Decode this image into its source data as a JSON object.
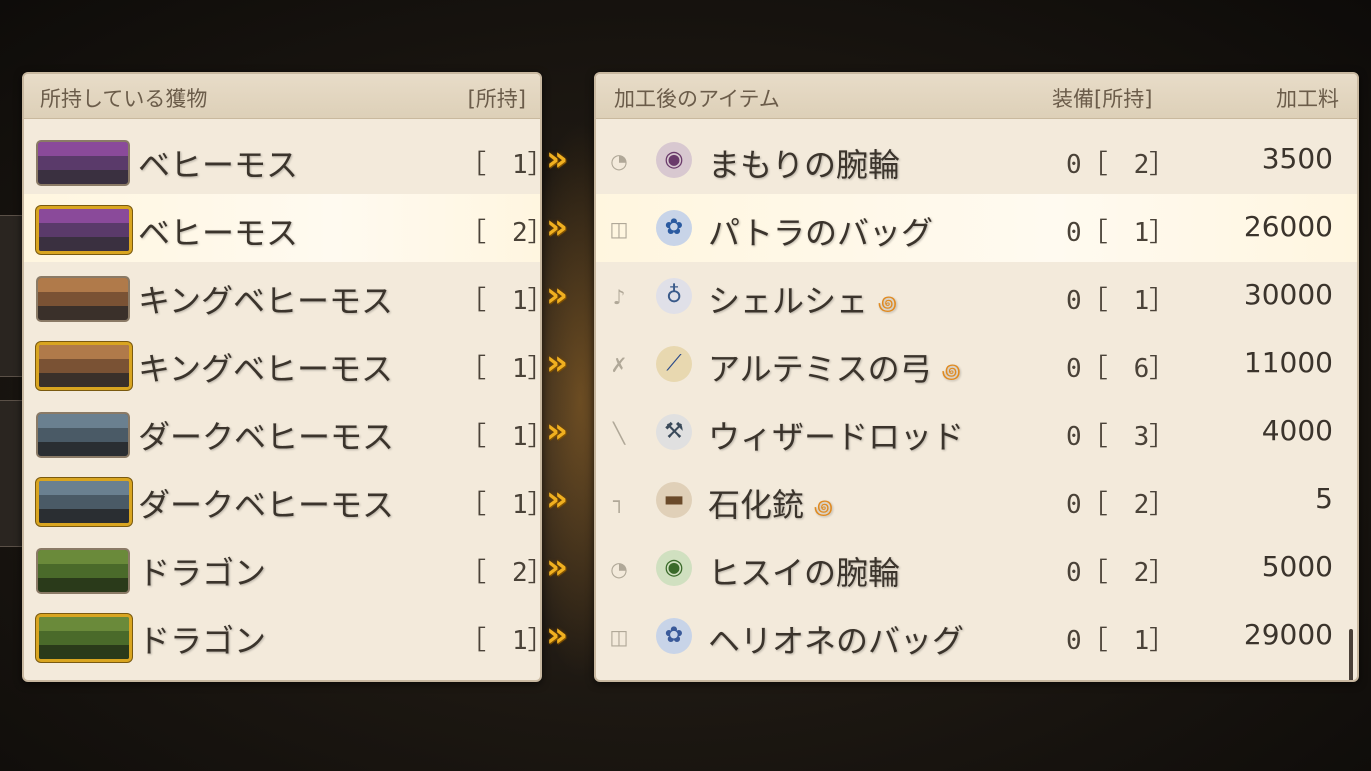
{
  "left_panel": {
    "header_title": "所持している獲物",
    "header_owned": "[所持]",
    "items": [
      {
        "name": "ベヒーモス",
        "sparkle": "",
        "count": "［　1］",
        "gold": false,
        "colors": [
          "#8a4a9a",
          "#5a3a6a",
          "#3a3040"
        ]
      },
      {
        "name": "ベヒーモス",
        "sparkle": "✦",
        "count": "［　2］",
        "gold": true,
        "colors": [
          "#8a4a9a",
          "#5a3a6a",
          "#3a3040"
        ]
      },
      {
        "name": "キングベヒーモス",
        "sparkle": "",
        "count": "［　1］",
        "gold": false,
        "colors": [
          "#b07a4a",
          "#7a5234",
          "#3a302a"
        ]
      },
      {
        "name": "キングベヒーモス",
        "sparkle": "✦",
        "count": "［　1］",
        "gold": true,
        "colors": [
          "#b07a4a",
          "#7a5234",
          "#3a302a"
        ]
      },
      {
        "name": "ダークベヒーモス",
        "sparkle": "",
        "count": "［　1］",
        "gold": false,
        "colors": [
          "#6a8090",
          "#4a5a66",
          "#2a2e32"
        ]
      },
      {
        "name": "ダークベヒーモス",
        "sparkle": "✦",
        "count": "［　1］",
        "gold": true,
        "colors": [
          "#6a8090",
          "#4a5a66",
          "#2a2e32"
        ]
      },
      {
        "name": "ドラゴン",
        "sparkle": "",
        "count": "［　2］",
        "gold": false,
        "colors": [
          "#6a8a3a",
          "#4a6a2a",
          "#2a3a1a"
        ]
      },
      {
        "name": "ドラゴン",
        "sparkle": "✦",
        "count": "［　1］",
        "gold": true,
        "colors": [
          "#6a8a3a",
          "#4a6a2a",
          "#2a3a1a"
        ]
      }
    ]
  },
  "right_panel": {
    "header_title": "加工後のアイテム",
    "header_equip": "装備[所持]",
    "header_fee": "加工料",
    "items": [
      {
        "category_icon": "bracelet-category-icon",
        "cat_glyph": "◔",
        "icon": "bracelet-icon",
        "icon_glyph": "◉",
        "icon_color": "#6a3a6a",
        "icon_bg": "#d8c8d0",
        "name": "まもりの腕輪",
        "material": "",
        "equip": "0［　2］",
        "fee": "3500"
      },
      {
        "category_icon": "bag-category-icon",
        "cat_glyph": "◫",
        "icon": "bag-icon",
        "icon_glyph": "✿",
        "icon_color": "#2a5aa0",
        "icon_bg": "#c8d4e8",
        "name": "パトラのバッグ",
        "material": "",
        "equip": "0［　1］",
        "fee": "26000"
      },
      {
        "category_icon": "accessory-category-icon",
        "cat_glyph": "♪",
        "icon": "potion-icon",
        "icon_glyph": "♁",
        "icon_color": "#3a5a8a",
        "icon_bg": "#e0e0e8",
        "name": "シェルシェ",
        "material": "꩜",
        "equip": "0［　1］",
        "fee": "30000"
      },
      {
        "category_icon": "bow-category-icon",
        "cat_glyph": "✗",
        "icon": "bow-icon",
        "icon_glyph": "⟋",
        "icon_color": "#2a4a8a",
        "icon_bg": "#e8d8b0",
        "name": "アルテミスの弓",
        "material": "꩜",
        "equip": "0［　6］",
        "fee": "11000"
      },
      {
        "category_icon": "rod-category-icon",
        "cat_glyph": "╲",
        "icon": "rod-icon",
        "icon_glyph": "⚒",
        "icon_color": "#3a4a5a",
        "icon_bg": "#e0e0e0",
        "name": "ウィザードロッド",
        "material": "",
        "equip": "0［　3］",
        "fee": "4000"
      },
      {
        "category_icon": "gun-category-icon",
        "cat_glyph": "┐",
        "icon": "gun-icon",
        "icon_glyph": "▬",
        "icon_color": "#6a4a2a",
        "icon_bg": "#e0d0b8",
        "name": "石化銃",
        "material": "꩜",
        "equip": "0［　2］",
        "fee": "5"
      },
      {
        "category_icon": "bracelet-category-icon",
        "cat_glyph": "◔",
        "icon": "bracelet-icon",
        "icon_glyph": "◉",
        "icon_color": "#3a6a2a",
        "icon_bg": "#d0e0c0",
        "name": "ヒスイの腕輪",
        "material": "",
        "equip": "0［　2］",
        "fee": "5000"
      },
      {
        "category_icon": "bag-category-icon",
        "cat_glyph": "◫",
        "icon": "bag-icon",
        "icon_glyph": "✿",
        "icon_color": "#3a5a9a",
        "icon_bg": "#c8d4e8",
        "name": "ヘリオネのバッグ",
        "material": "",
        "equip": "0［　1］",
        "fee": "29000"
      }
    ]
  },
  "arrow_glyph": "»",
  "selected_index": 1
}
